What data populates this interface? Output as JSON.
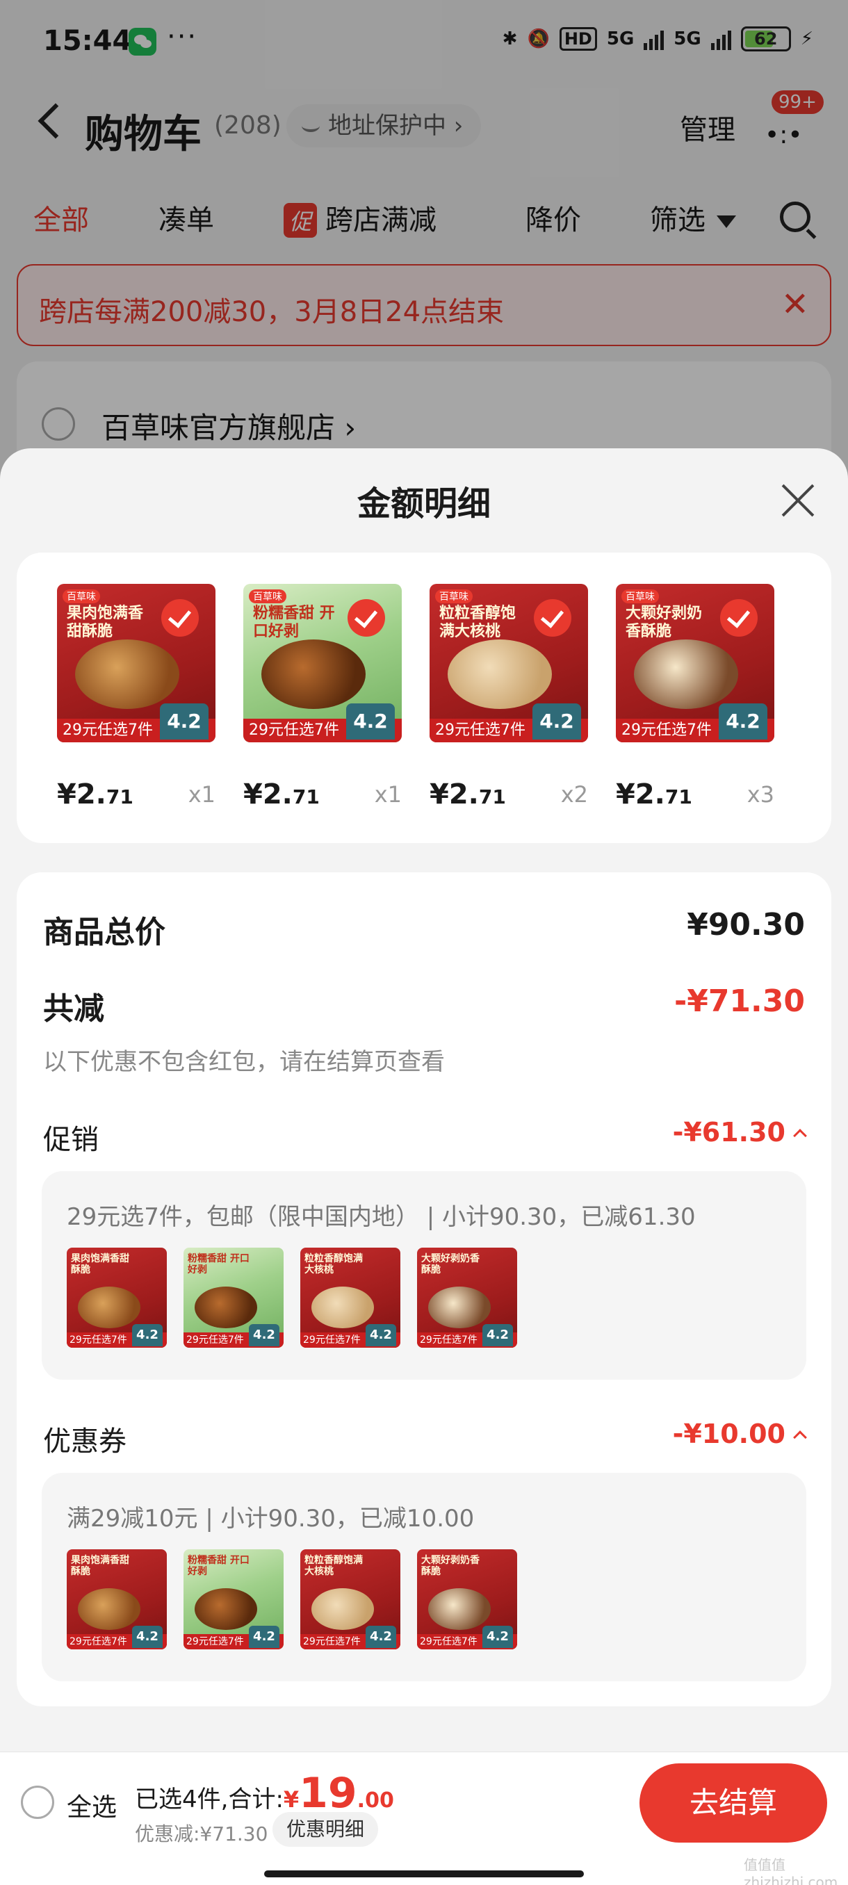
{
  "status": {
    "time": "15:44",
    "more": "···",
    "network": "HD",
    "sig1": "5G",
    "sig2": "5G",
    "battery": "62"
  },
  "nav": {
    "title": "购物车",
    "count": "(208)",
    "address": "地址保护中 ›",
    "manage": "管理",
    "more_icon": "•:•",
    "badge": "99+"
  },
  "tabs": [
    "全部",
    "凑单",
    "跨店满减",
    "降价",
    "筛选"
  ],
  "promo_tag": "促",
  "banner": {
    "text": "跨店每满200减30，3月8日24点结束",
    "close": "✕"
  },
  "store": {
    "name": "百草味官方旗舰店 ›"
  },
  "sheet": {
    "title": "金额明细",
    "products": [
      {
        "slogan": "果肉饱满香甜酥脆",
        "deal": "29元任选7件",
        "tag": "4.2",
        "price_int": "¥2.",
        "price_dec": "71",
        "qty": "x1",
        "kind": "nuts",
        "green": false
      },
      {
        "slogan": "粉糯香甜 开口好剥",
        "deal": "29元任选7件",
        "tag": "4.2",
        "price_int": "¥2.",
        "price_dec": "71",
        "qty": "x1",
        "kind": "chestnut",
        "green": true
      },
      {
        "slogan": "粒粒香醇饱满大核桃",
        "deal": "29元任选7件",
        "tag": "4.2",
        "price_int": "¥2.",
        "price_dec": "71",
        "qty": "x2",
        "kind": "walnut",
        "green": false
      },
      {
        "slogan": "大颗好剥奶香酥脆",
        "deal": "29元任选7件",
        "tag": "4.2",
        "price_int": "¥2.",
        "price_dec": "71",
        "qty": "x3",
        "kind": "maca",
        "green": false
      }
    ],
    "total_label": "商品总价",
    "total_value": "¥90.30",
    "reduce_label": "共减",
    "reduce_value": "-¥71.30",
    "note": "以下优惠不包含红包，请在结算页查看",
    "promo": {
      "label": "促销",
      "value": "-¥61.30",
      "detail": "29元选7件，包邮（限中国内地） | 小计90.30，已减61.30"
    },
    "coupon": {
      "label": "优惠券",
      "value": "-¥10.00",
      "detail": "满29减10元 | 小计90.30，已减10.00"
    }
  },
  "bottom": {
    "select_all": "全选",
    "selected": "已选4件,合计:",
    "currency": "¥",
    "amount_int": "19",
    "amount_dec": ".00",
    "discount": "优惠减:¥71.30",
    "detail_btn": "优惠明细",
    "checkout": "去结算",
    "watermark": "值值值 zhizhizhi.com"
  },
  "colors": {
    "accent": "#e8392e",
    "tag": "#2f6b78"
  }
}
